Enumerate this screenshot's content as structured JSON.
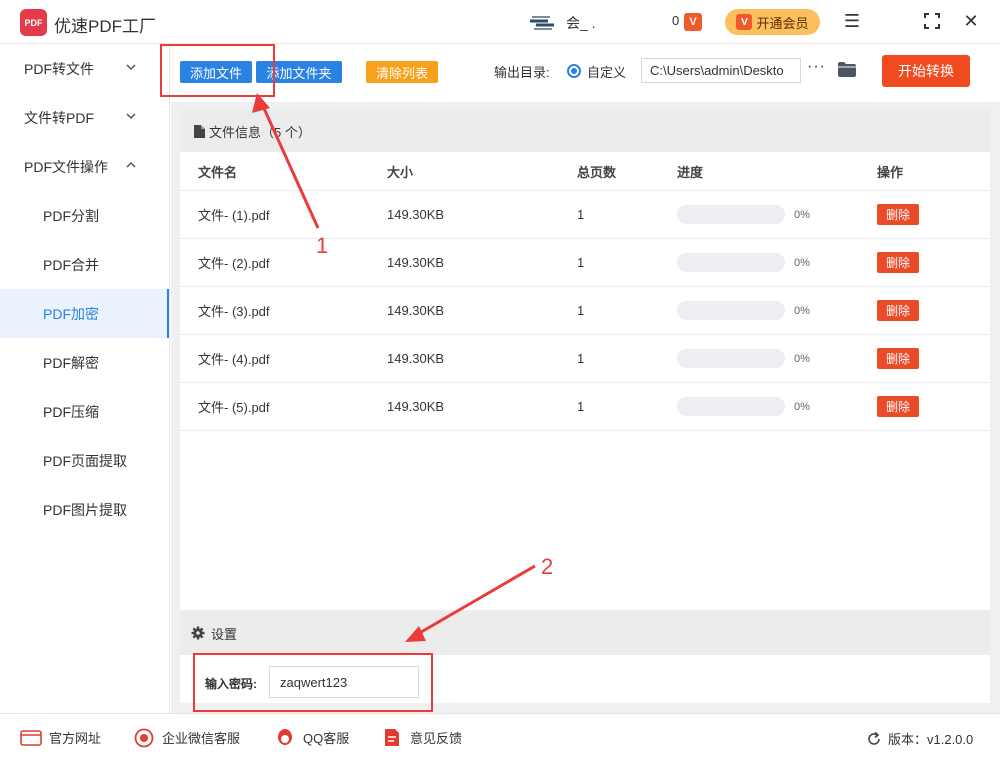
{
  "app": {
    "title": "优速PDF工厂",
    "logo_text": "PDF"
  },
  "user": {
    "name": "会_ .",
    "badge": "0",
    "vip_mini": "V",
    "vip_label": "开通会员"
  },
  "window": {
    "menu": "☰",
    "max": "⛶",
    "close": "✕"
  },
  "sidebar": {
    "groups": [
      {
        "label": "PDF转文件",
        "expanded": false
      },
      {
        "label": "文件转PDF",
        "expanded": false
      },
      {
        "label": "PDF文件操作",
        "expanded": true
      }
    ],
    "items": [
      "PDF分割",
      "PDF合并",
      "PDF加密",
      "PDF解密",
      "PDF压缩",
      "PDF页面提取",
      "PDF图片提取"
    ],
    "active_item": "PDF加密"
  },
  "toolbar": {
    "add_file": "添加文件",
    "add_folder": "添加文件夹",
    "clear_list": "清除列表",
    "output_label": "输出目录:",
    "custom_label": "自定义",
    "output_path": "C:\\Users\\admin\\Deskto",
    "more": "···",
    "start": "开始转换"
  },
  "files": {
    "header": "文件信息（5 个）",
    "columns": [
      "文件名",
      "大小",
      "总页数",
      "进度",
      "操作"
    ],
    "rows": [
      {
        "name": "文件- (1).pdf",
        "size": "149.30KB",
        "pages": "1",
        "progress": "0%",
        "action": "删除"
      },
      {
        "name": "文件- (2).pdf",
        "size": "149.30KB",
        "pages": "1",
        "progress": "0%",
        "action": "删除"
      },
      {
        "name": "文件- (3).pdf",
        "size": "149.30KB",
        "pages": "1",
        "progress": "0%",
        "action": "删除"
      },
      {
        "name": "文件- (4).pdf",
        "size": "149.30KB",
        "pages": "1",
        "progress": "0%",
        "action": "删除"
      },
      {
        "name": "文件- (5).pdf",
        "size": "149.30KB",
        "pages": "1",
        "progress": "0%",
        "action": "删除"
      }
    ]
  },
  "settings": {
    "title": "设置",
    "password_label": "输入密码:",
    "password_value": "zaqwert123"
  },
  "annotations": {
    "n1": "1",
    "n2": "2"
  },
  "footer": {
    "website": "官方网址",
    "wechat": "企业微信客服",
    "qq": "QQ客服",
    "feedback": "意见反馈",
    "version": "版本：v1.2.0.0",
    "website_icon_text": ".com"
  },
  "colors": {
    "accent": "#2a82e4",
    "danger": "#e94b27",
    "warning": "#f7a21c",
    "annotation": "#ec3b3b"
  }
}
